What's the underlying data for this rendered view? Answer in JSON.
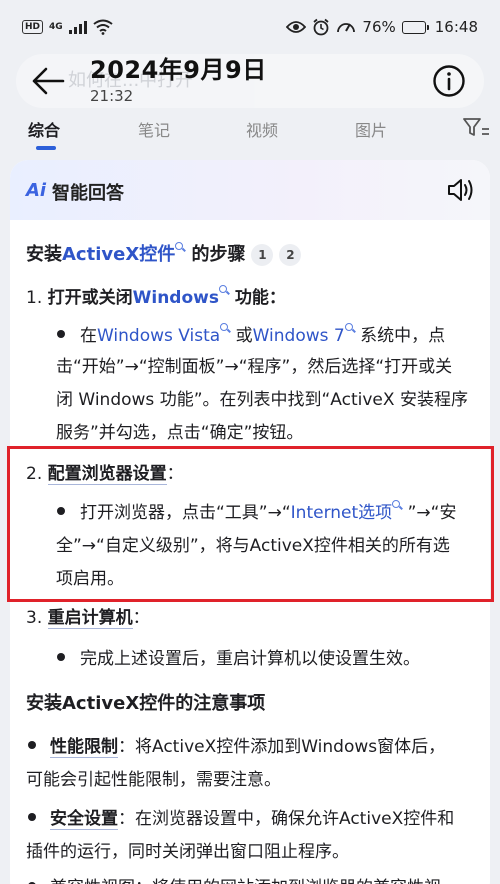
{
  "status_bar": {
    "hd": "HD",
    "network": "4G",
    "battery": "76%",
    "battery_level": 0.76,
    "time": "16:48",
    "icons": [
      "eye-icon",
      "alarm-icon",
      "speed-icon",
      "battery-icon"
    ]
  },
  "header": {
    "date": "2024年9月9日",
    "time": "21:32",
    "search_ghost": "如何在...中打开"
  },
  "tabs": [
    {
      "label": "综合",
      "active": true
    },
    {
      "label": "笔记",
      "active": false
    },
    {
      "label": "视频",
      "active": false
    },
    {
      "label": "图片",
      "active": false
    }
  ],
  "card": {
    "ai_logo": "Ai",
    "title": "智能回答"
  },
  "content": {
    "heading1_pre": "安装",
    "heading1_link": "ActiveX控件",
    "heading1_post": " 的步骤",
    "refs": [
      "1",
      "2"
    ],
    "step1_num": "1. ",
    "step1_pre": "打开或关闭",
    "step1_link": "Windows",
    "step1_post": " 功能：",
    "b1_l1_a": "在",
    "b1_l1_link1": "Windows Vista",
    "b1_l1_b": " 或",
    "b1_l1_link2": "Windows 7",
    "b1_l1_c": " 系统中，点",
    "b1_l2": "击“开始”→“控制面板”→“程序”，然后选择“打开或关",
    "b1_l3": "闭 Windows 功能”。在列表中找到“ActiveX 安装程序",
    "b1_l4": "服务”并勾选，点击“确定”按钮。",
    "step2_num": "2. ",
    "step2_text": "配置浏览器设置",
    "step2_colon": "：",
    "b2_l1_a": "打开浏览器，点击“工具”→“",
    "b2_l1_link": "Internet选项",
    "b2_l1_b": " ”→“安",
    "b2_l2": "全”→“自定义级别”，将与ActiveX控件相关的所有选",
    "b2_l3": "项启用。",
    "step3_num": "3. ",
    "step3_text": "重启计算机",
    "step3_colon": "：",
    "b3_l1": "完成上述设置后，重启计算机以使设置生效。",
    "heading2": "安装ActiveX控件的注意事项",
    "n1_label": "性能限制",
    "n1_l1": "：将ActiveX控件添加到Windows窗体后，",
    "n1_l2": "可能会引起性能限制，需要注意。",
    "n2_label": "安全设置",
    "n2_l1": "：在浏览器设置中，确保允许ActiveX控件和",
    "n2_l2": "插件的运行，同时关闭弹出窗口阻止程序。",
    "n3_partial": "兼容性视图：将使用的网站添加到浏览器的兼容性视"
  }
}
